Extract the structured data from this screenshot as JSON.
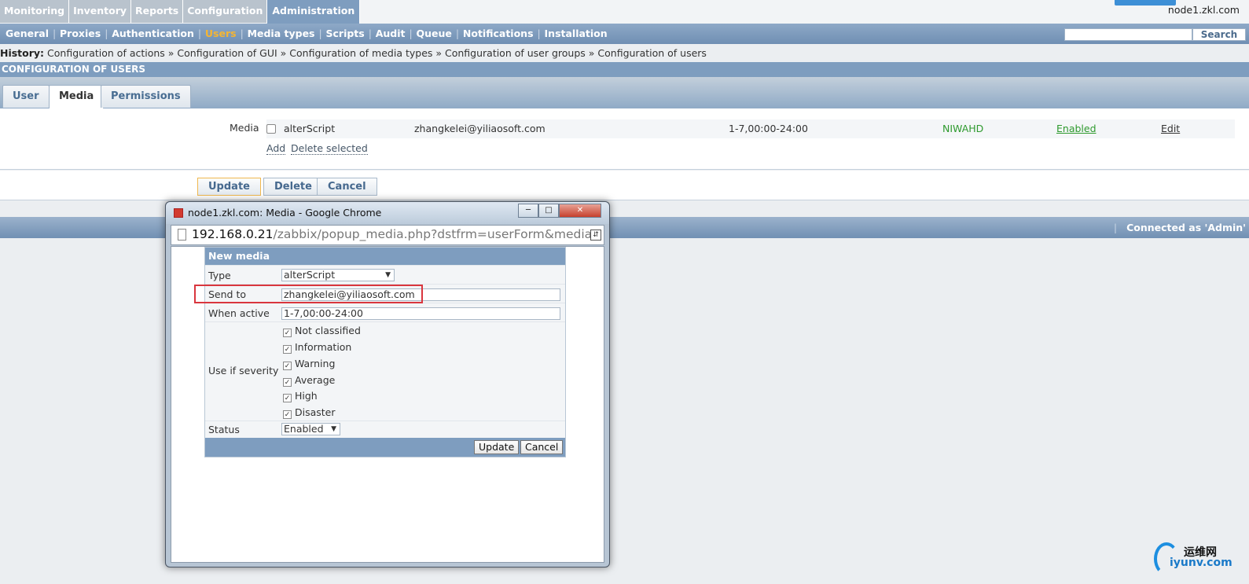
{
  "main_menu": [
    "Monitoring",
    "Inventory",
    "Reports",
    "Configuration",
    "Administration"
  ],
  "host": "node1.zkl.com",
  "sub_menu": [
    "General",
    "Proxies",
    "Authentication",
    "Users",
    "Media types",
    "Scripts",
    "Audit",
    "Queue",
    "Notifications",
    "Installation"
  ],
  "search_button": "Search",
  "history": {
    "label": "History:",
    "items": "Configuration of actions » Configuration of GUI » Configuration of media types » Configuration of user groups » Configuration of users"
  },
  "section_title": "CONFIGURATION OF USERS",
  "tabs": [
    "User",
    "Media",
    "Permissions"
  ],
  "media": {
    "label": "Media",
    "row": {
      "type": "alterScript",
      "send_to": "zhangkelei@yiliaosoft.com",
      "when_active": "1-7,00:00-24:00",
      "severity": "NIWAHD",
      "status": "Enabled",
      "edit": "Edit"
    },
    "add": "Add",
    "delete_selected": "Delete selected"
  },
  "buttons": {
    "update": "Update",
    "delete": "Delete",
    "cancel": "Cancel"
  },
  "footer": {
    "connected": "Connected as 'Admin'"
  },
  "popup": {
    "title": "node1.zkl.com: Media - Google Chrome",
    "url_host": "192.168.0.21",
    "url_path": "/zabbix/popup_media.php?dstfrm=userForm&media",
    "form": {
      "header": "New media",
      "type_label": "Type",
      "type_value": "alterScript",
      "send_to_label": "Send to",
      "send_to_value": "zhangkelei@yiliaosoft.com",
      "when_active_label": "When active",
      "when_active_value": "1-7,00:00-24:00",
      "severity_label": "Use if severity",
      "severities": [
        "Not classified",
        "Information",
        "Warning",
        "Average",
        "High",
        "Disaster"
      ],
      "status_label": "Status",
      "status_value": "Enabled",
      "update": "Update",
      "cancel": "Cancel"
    }
  },
  "watermark": {
    "top": "运维网",
    "bottom": "iyunv.com"
  },
  "colors": {
    "accent": "#7e9dbf",
    "active_menu": "#f5b532",
    "status_green": "#2e9a2e",
    "highlight": "#d9363e"
  }
}
